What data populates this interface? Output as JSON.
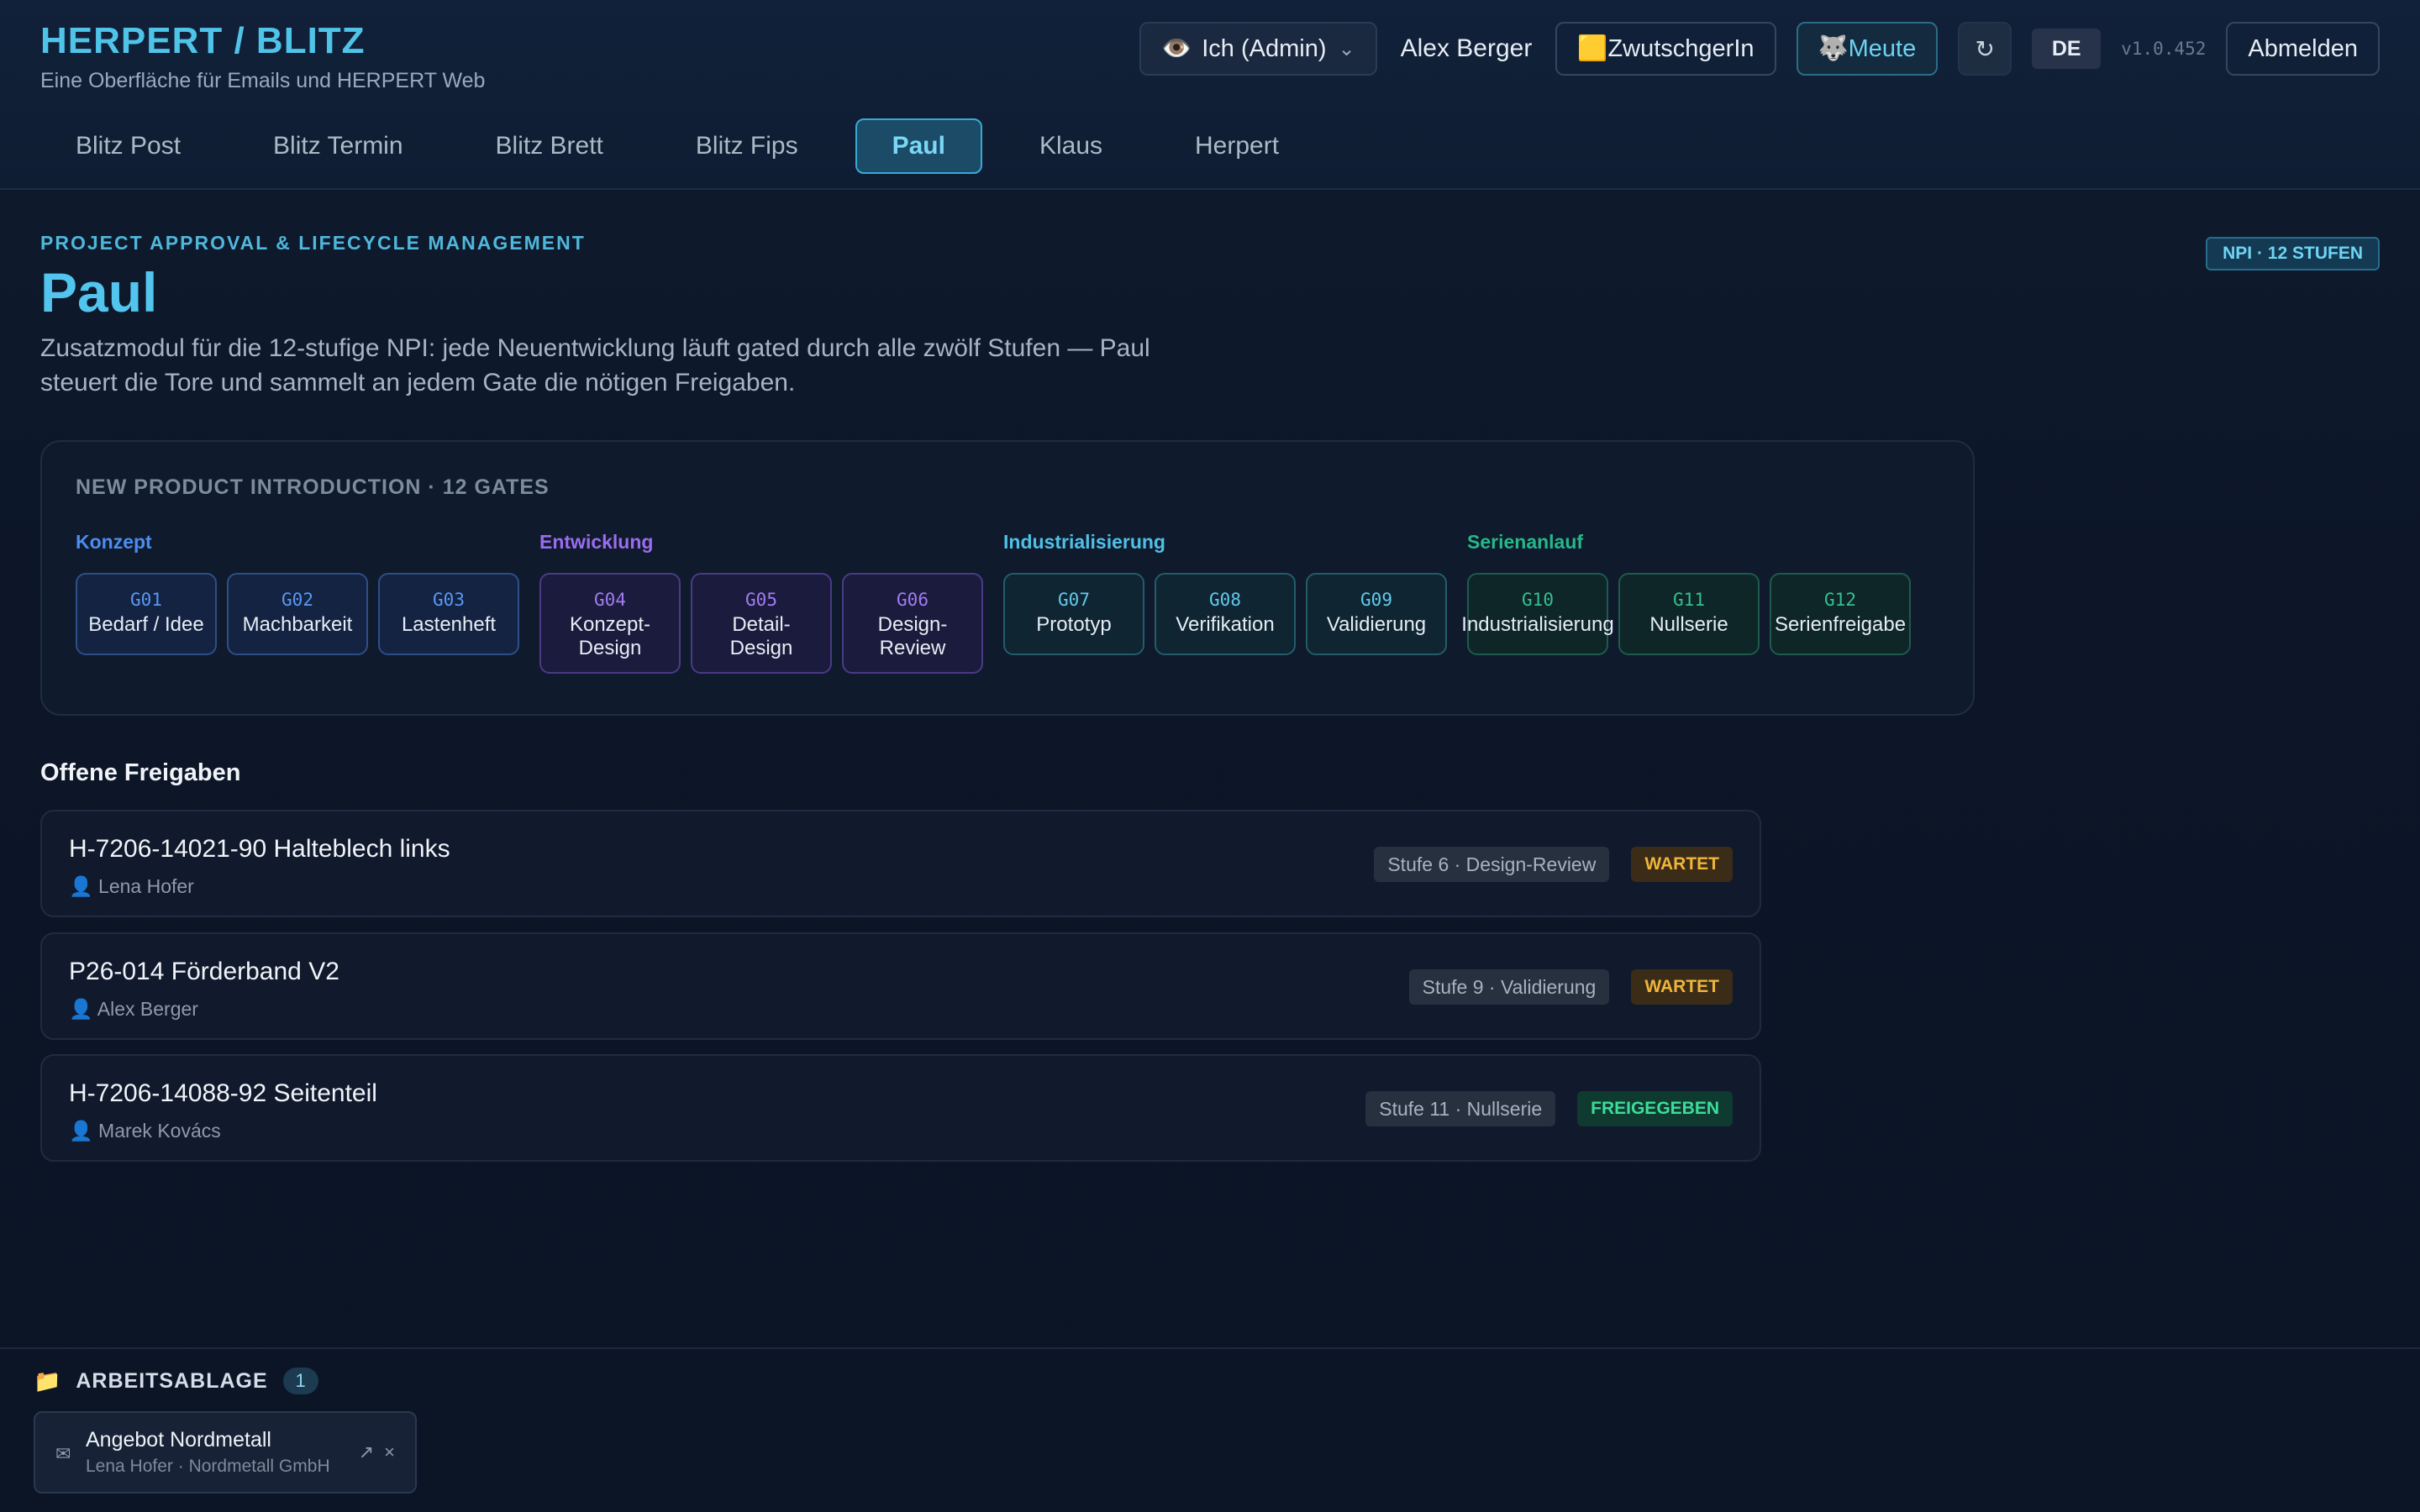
{
  "app": {
    "brand": "HERPERT / BLITZ",
    "subtitle": "Eine Oberfläche für Emails und HERPERT Web"
  },
  "topbar": {
    "role_icon": "👁️",
    "role_label": "Ich (Admin)",
    "user_name": "Alex Berger",
    "btn_zwutschgerin_icon": "🟨",
    "btn_zwutschgerin": "ZwutschgerIn",
    "btn_meute_icon": "🐺",
    "btn_meute": "Meute",
    "refresh_icon": "↻",
    "lang": "DE",
    "version": "v1.0.452",
    "logout": "Abmelden"
  },
  "nav": {
    "tabs": [
      "Blitz Post",
      "Blitz Termin",
      "Blitz Brett",
      "Blitz Fips",
      "Paul",
      "Klaus",
      "Herpert"
    ],
    "active": "Paul"
  },
  "page": {
    "kicker": "PROJECT APPROVAL & LIFECYCLE MANAGEMENT",
    "title": "Paul",
    "description": "Zusatzmodul für die 12-stufige NPI: jede Neuentwicklung läuft gated durch alle zwölf Stufen — Paul steuert die Tore und sammelt an jedem Gate die nötigen Freigaben.",
    "badge": "NPI · 12 STUFEN"
  },
  "gates": {
    "title": "NEW PRODUCT INTRODUCTION · 12 GATES",
    "phases": [
      {
        "label": "Konzept",
        "color": "#4c8df0",
        "gates": [
          {
            "code": "G01",
            "name": "Bedarf / Idee"
          },
          {
            "code": "G02",
            "name": "Machbarkeit"
          },
          {
            "code": "G03",
            "name": "Lastenheft"
          }
        ]
      },
      {
        "label": "Entwicklung",
        "color": "#9b6cf0",
        "gates": [
          {
            "code": "G04",
            "name": "Konzept-Design"
          },
          {
            "code": "G05",
            "name": "Detail-Design"
          },
          {
            "code": "G06",
            "name": "Design-Review"
          }
        ]
      },
      {
        "label": "Industrialisierung",
        "color": "#4fc1e6",
        "gates": [
          {
            "code": "G07",
            "name": "Prototyp"
          },
          {
            "code": "G08",
            "name": "Verifikation"
          },
          {
            "code": "G09",
            "name": "Validierung"
          }
        ]
      },
      {
        "label": "Serienanlauf",
        "color": "#26b889",
        "gates": [
          {
            "code": "G10",
            "name": "Industrialisierung"
          },
          {
            "code": "G11",
            "name": "Nullserie"
          },
          {
            "code": "G12",
            "name": "Serienfreigabe"
          }
        ]
      }
    ]
  },
  "approvals": {
    "title": "Offene Freigaben",
    "person_icon": "👤",
    "items": [
      {
        "title": "H-7206-14021-90 Halteblech links",
        "person": "Lena Hofer",
        "stage": "Stufe 6 · Design-Review",
        "status": "WARTET"
      },
      {
        "title": "P26-014 Förderband V2",
        "person": "Alex Berger",
        "stage": "Stufe 9 · Validierung",
        "status": "WARTET"
      },
      {
        "title": "H-7206-14088-92 Seitenteil",
        "person": "Marek Kovács",
        "stage": "Stufe 11 · Nullserie",
        "status": "FREIGEGEBEN"
      }
    ]
  },
  "shelf": {
    "icon": "📁",
    "title": "ARBEITSABLAGE",
    "count": "1",
    "card": {
      "icon": "✉",
      "title": "Angebot Nordmetall",
      "sub": "Lena Hofer · Nordmetall GmbH",
      "open_icon": "↗",
      "close_icon": "×"
    }
  }
}
